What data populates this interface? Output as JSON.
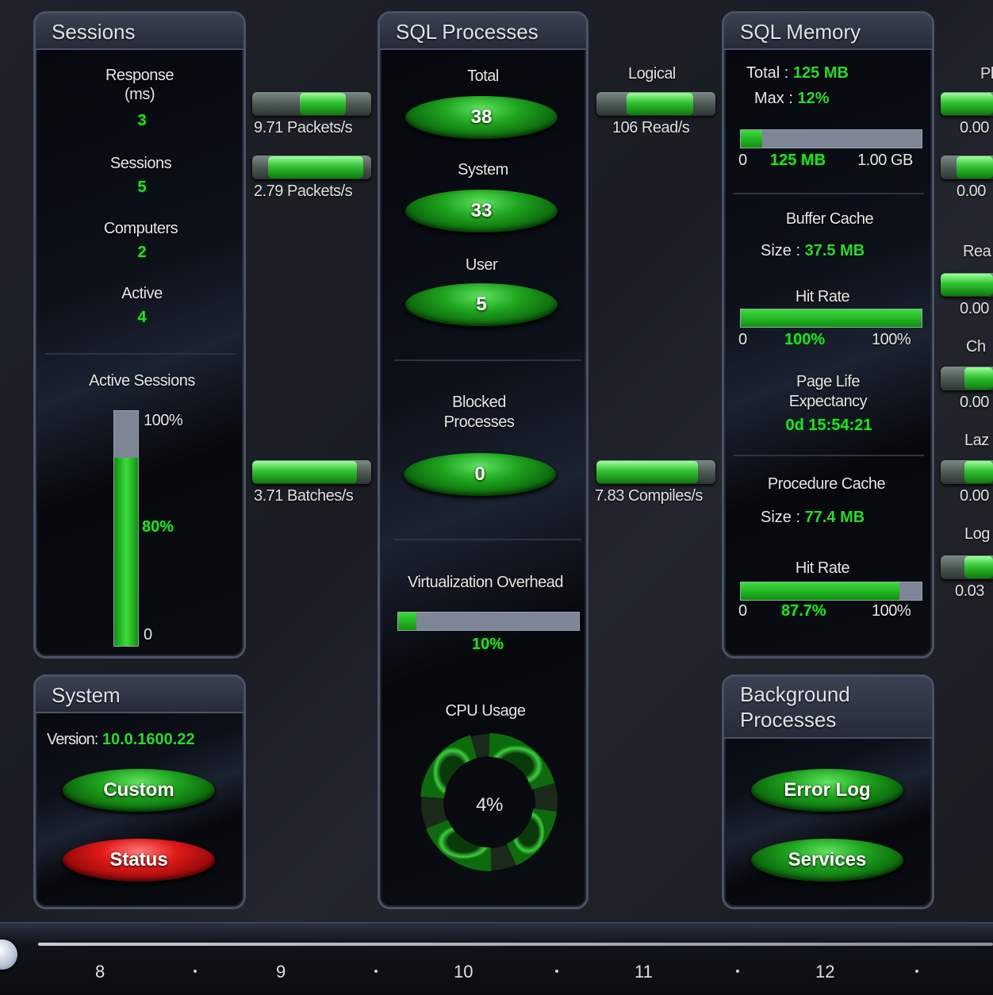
{
  "sessions": {
    "title": "Sessions",
    "response_label": "Response\n(ms)",
    "response_value": "3",
    "sessions_label": "Sessions",
    "sessions_value": "5",
    "computers_label": "Computers",
    "computers_value": "2",
    "active_label": "Active",
    "active_value": "4",
    "active_sessions_label": "Active Sessions",
    "gauge_top": "100%",
    "gauge_value": "80%",
    "gauge_bottom": "0",
    "gauge_fraction": 0.8
  },
  "system": {
    "title": "System",
    "version_label": "Version:",
    "version_value": "10.0.1600.22",
    "custom_button": "Custom",
    "status_button": "Status"
  },
  "links": {
    "packets_in": "9.71 Packets/s",
    "packets_out": "2.79 Packets/s",
    "batches": "3.71 Batches/s",
    "logical_label": "Logical",
    "reads": "106 Read/s",
    "compiles": "7.83 Compiles/s"
  },
  "sql_processes": {
    "title": "SQL Processes",
    "total_label": "Total",
    "total_value": "38",
    "system_label": "System",
    "system_value": "33",
    "user_label": "User",
    "user_value": "5",
    "blocked_label": "Blocked\nProcesses",
    "blocked_value": "0",
    "virt_label": "Virtualization Overhead",
    "virt_value": "10%",
    "virt_fraction": 0.1,
    "cpu_label": "CPU Usage",
    "cpu_value": "4%"
  },
  "sql_memory": {
    "title": "SQL Memory",
    "total_label": "Total :",
    "total_value": "125 MB",
    "max_label": "Max :",
    "max_value": "12%",
    "mem_bar_fraction": 0.12,
    "mem_min": "0",
    "mem_current": "125 MB",
    "mem_max": "1.00 GB",
    "buffer_label": "Buffer Cache",
    "buffer_size_label": "Size :",
    "buffer_size_value": "37.5 MB",
    "buffer_hit_label": "Hit Rate",
    "buffer_hit_fraction": 1.0,
    "buffer_min": "0",
    "buffer_value": "100%",
    "buffer_max": "100%",
    "ple_label": "Page Life\nExpectancy",
    "ple_value": "0d 15:54:21",
    "proc_label": "Procedure Cache",
    "proc_size_label": "Size :",
    "proc_size_value": "77.4 MB",
    "proc_hit_label": "Hit Rate",
    "proc_hit_fraction": 0.877,
    "proc_min": "0",
    "proc_value": "87.7%",
    "proc_max": "100%"
  },
  "background": {
    "title": "Background\nProcesses",
    "error_log_button": "Error Log",
    "services_button": "Services"
  },
  "right_edge": {
    "labels": [
      "Pl",
      "Rea",
      "Ch",
      "Laz",
      "Log"
    ],
    "values": [
      "0.00",
      "0.00",
      "0.00",
      "0.00",
      "0.00",
      "0.03"
    ]
  },
  "timeline": {
    "ticks": [
      "8",
      "9",
      "10",
      "11",
      "12"
    ]
  }
}
